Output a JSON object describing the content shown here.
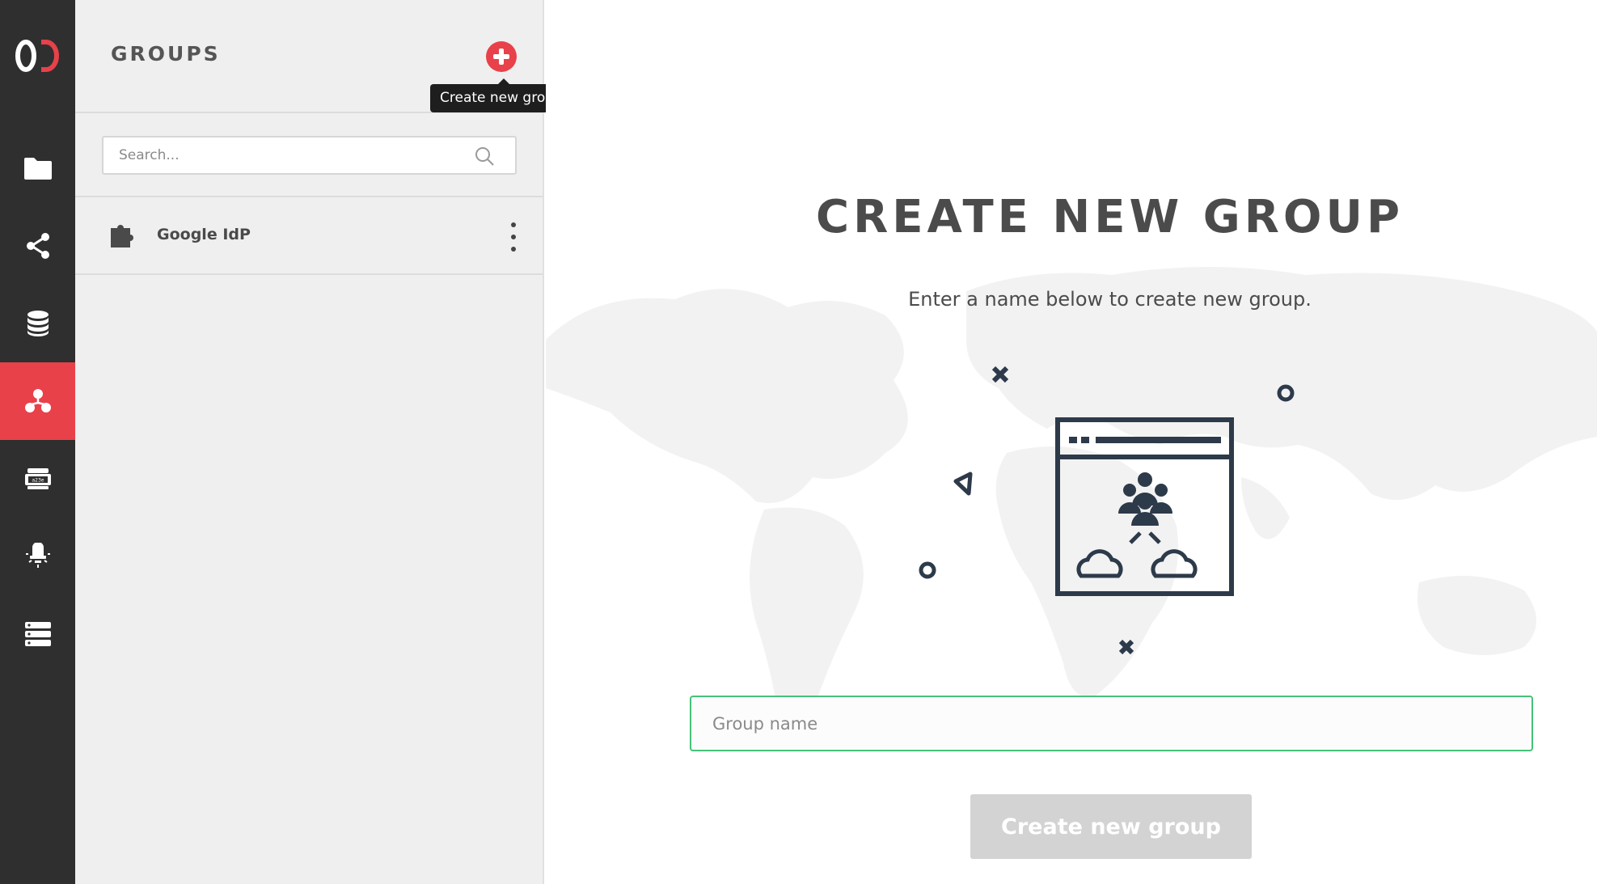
{
  "brand": {
    "logo_text": "OD",
    "accent_color": "#e8414a"
  },
  "rail": {
    "items": [
      {
        "icon": "folder-icon",
        "active": false
      },
      {
        "icon": "share-icon",
        "active": false
      },
      {
        "icon": "database-icon",
        "active": false
      },
      {
        "icon": "groups-icon",
        "active": true
      },
      {
        "icon": "storage-device-icon",
        "active": false
      },
      {
        "icon": "lightbulb-icon",
        "active": false
      },
      {
        "icon": "server-list-icon",
        "active": false
      }
    ]
  },
  "groups_panel": {
    "title": "GROUPS",
    "add_tooltip": "Create new group",
    "search": {
      "placeholder": "Search...",
      "value": ""
    },
    "groups": [
      {
        "name": "Google IdP",
        "icon": "puzzle-icon"
      }
    ]
  },
  "main": {
    "title": "CREATE NEW GROUP",
    "subtitle": "Enter a name below to create new group.",
    "group_name_field": {
      "placeholder": "Group name",
      "value": ""
    },
    "submit_label": "Create new group",
    "field_focus_color": "#45c27a"
  }
}
